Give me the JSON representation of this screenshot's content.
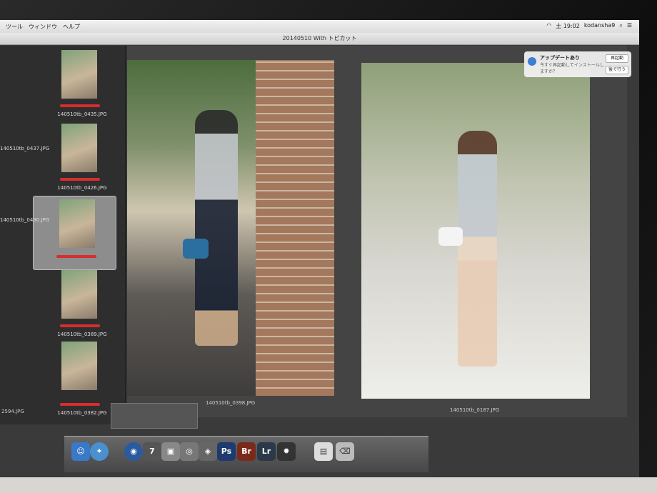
{
  "menubar": {
    "items": [
      "ツール",
      "ウィンドウ",
      "ヘルプ"
    ],
    "clock": "土 19:02",
    "user": "kodansha9"
  },
  "window": {
    "title": "20140510 With トピカット"
  },
  "filmstrip": {
    "thumbs": [
      {
        "label": "140510tb_0437.JPG"
      },
      {
        "label": "140510tb_0435.JPG"
      },
      {
        "label": "140510tb_0430.JPG"
      },
      {
        "label": "140510tb_0426.JPG"
      },
      {
        "label": "140510tb_0398.JPG"
      },
      {
        "label": "140510tb_0389.JPG"
      },
      {
        "label": "140510tb_0382.JPG"
      }
    ]
  },
  "viewer": {
    "left_caption": "140510tb_0398.JPG",
    "right_caption": "140510tb_0187.JPG"
  },
  "notification": {
    "title": "アップデートあり",
    "desc": "今すぐ再起動してインストールしますか？",
    "restart_label": "再起動",
    "later_label": "後で行う"
  },
  "dock": {
    "apps": [
      {
        "name": "Ps",
        "color": "#1e3a6e"
      },
      {
        "name": "Br",
        "color": "#7a2a1a"
      },
      {
        "name": "Lr",
        "color": "#2a3a4a"
      }
    ]
  },
  "status": {
    "bottom_left": "2594.JPG"
  }
}
